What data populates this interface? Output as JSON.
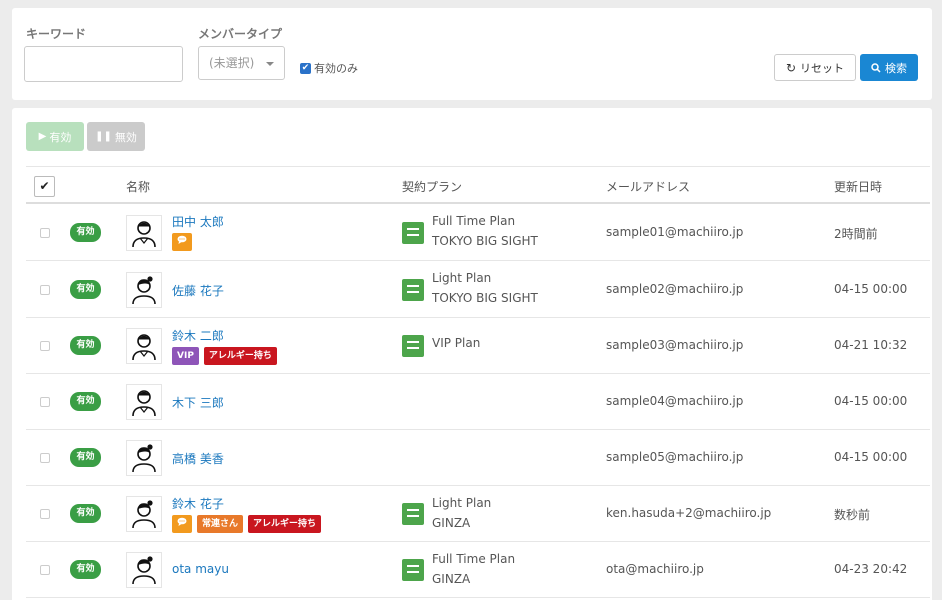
{
  "filters": {
    "keyword_label": "キーワード",
    "keyword_value": "",
    "member_type_label": "メンバータイプ",
    "member_type_value": "(未選択)",
    "active_only_label": "有効のみ",
    "reset_label": "リセット",
    "search_label": "検索"
  },
  "actions": {
    "enable_label": "有効",
    "disable_label": "無効"
  },
  "table": {
    "headers": {
      "name": "名称",
      "plan": "契約プラン",
      "email": "メールアドレス",
      "updated": "更新日時"
    },
    "rows": [
      {
        "status": "有効",
        "avatar": "male-avatar",
        "name": "田中 太郎",
        "tags": [
          {
            "type": "chat",
            "label": ""
          }
        ],
        "plan_name": "Full Time Plan",
        "plan_place": "TOKYO BIG SIGHT",
        "email": "sample01@machiiro.jp",
        "updated": "2時間前"
      },
      {
        "status": "有効",
        "avatar": "female-avatar",
        "name": "佐藤 花子",
        "tags": [],
        "plan_name": "Light Plan",
        "plan_place": "TOKYO BIG SIGHT",
        "email": "sample02@machiiro.jp",
        "updated": "04-15 00:00"
      },
      {
        "status": "有効",
        "avatar": "male-avatar",
        "name": "鈴木 二郎",
        "tags": [
          {
            "type": "vip",
            "label": "VIP"
          },
          {
            "type": "allergy",
            "label": "アレルギー持ち"
          }
        ],
        "plan_name": "VIP Plan",
        "plan_place": "",
        "email": "sample03@machiiro.jp",
        "updated": "04-21 10:32"
      },
      {
        "status": "有効",
        "avatar": "male-avatar",
        "name": "木下 三郎",
        "tags": [],
        "plan_name": "",
        "plan_place": "",
        "email": "sample04@machiiro.jp",
        "updated": "04-15 00:00"
      },
      {
        "status": "有効",
        "avatar": "female-avatar",
        "name": "高橋 美香",
        "tags": [],
        "plan_name": "",
        "plan_place": "",
        "email": "sample05@machiiro.jp",
        "updated": "04-15 00:00"
      },
      {
        "status": "有効",
        "avatar": "female-avatar",
        "name": "鈴木 花子",
        "tags": [
          {
            "type": "chat",
            "label": ""
          },
          {
            "type": "regular",
            "label": "常連さん"
          },
          {
            "type": "allergy",
            "label": "アレルギー持ち"
          }
        ],
        "plan_name": "Light Plan",
        "plan_place": "GINZA",
        "email": "ken.hasuda+2@machiiro.jp",
        "updated": "数秒前"
      },
      {
        "status": "有効",
        "avatar": "female-avatar",
        "name": "ota mayu",
        "tags": [],
        "plan_name": "Full Time Plan",
        "plan_place": "GINZA",
        "email": "ota@machiiro.jp",
        "updated": "04-23 20:42"
      }
    ]
  }
}
